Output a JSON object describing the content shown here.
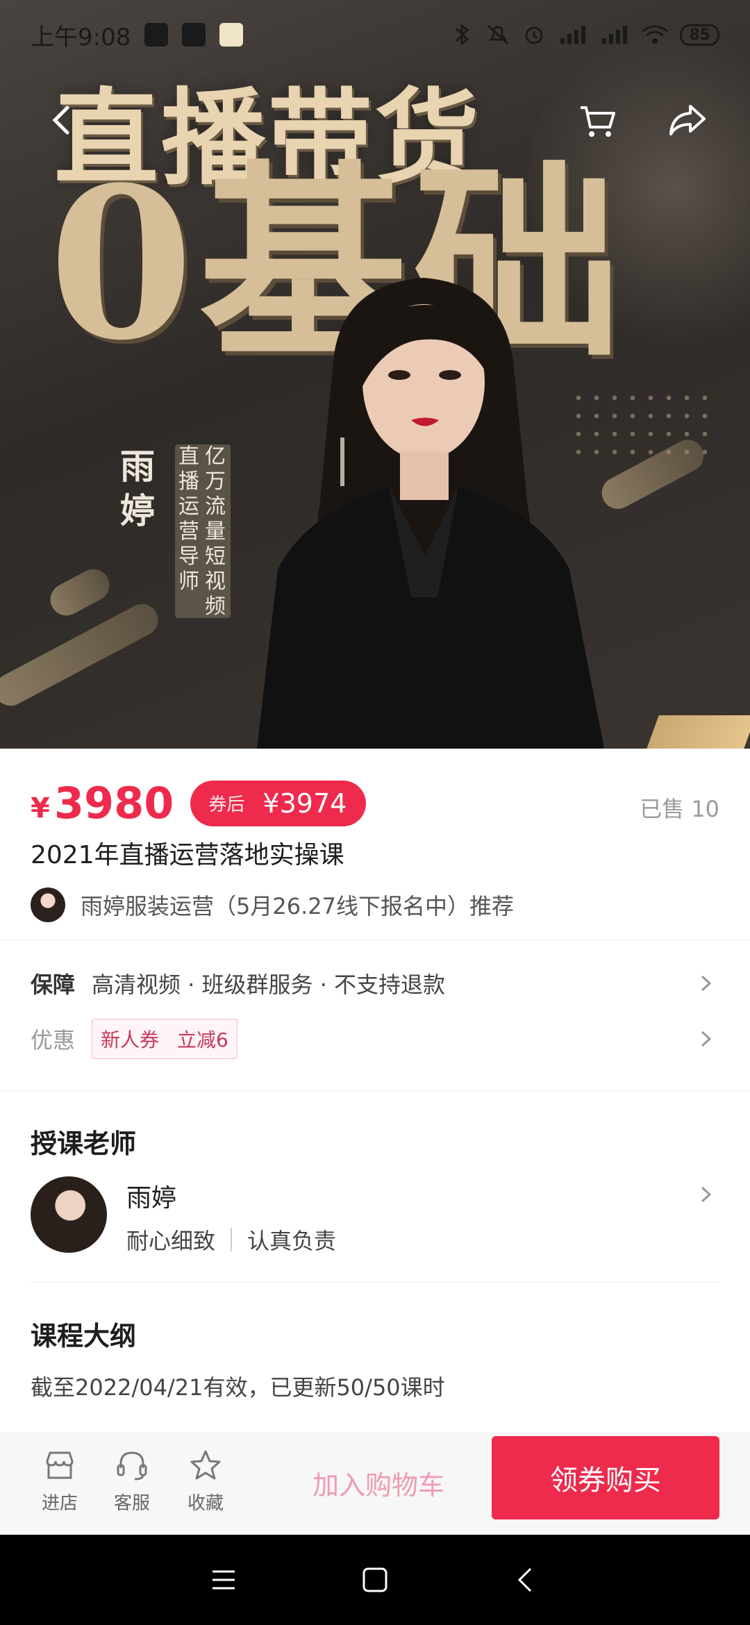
{
  "status_bar": {
    "time": "上午9:08",
    "battery": "85"
  },
  "hero": {
    "title_line1": "直播带货",
    "title_line2": "0基础",
    "teacher_name": "雨婷",
    "tag_col1": "直播运营导师",
    "tag_col2": "亿万流量短视频"
  },
  "product": {
    "currency": "¥",
    "price": "3980",
    "coupon_label": "券后",
    "coupon_price": "¥3974",
    "sold": "已售 10",
    "title": "2021年直播运营落地实操课",
    "shop": "雨婷服装运营（5月26.27线下报名中）推荐"
  },
  "guarantee": {
    "label": "保障",
    "text": "高清视频 · 班级群服务 · 不支持退款",
    "discount_label": "优惠",
    "coupon_tag1": "新人券",
    "coupon_tag2": "立减6"
  },
  "teacher": {
    "section_title": "授课老师",
    "name": "雨婷",
    "tag1": "耐心细致",
    "tag2": "认真负责"
  },
  "outline": {
    "section_title": "课程大纲",
    "subtitle": "截至2022/04/21有效，已更新50/50课时"
  },
  "bottom_bar": {
    "store": "进店",
    "service": "客服",
    "favorite": "收藏",
    "add_cart": "加入购物车",
    "buy": "领券购买"
  },
  "colors": {
    "accent": "#ee2b4d",
    "gold": "#d6bf98"
  }
}
